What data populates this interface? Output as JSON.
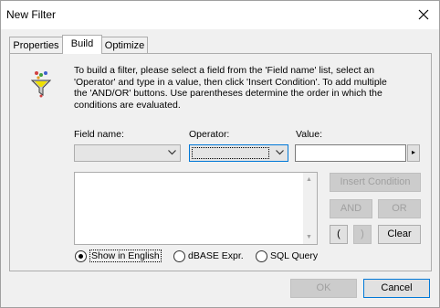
{
  "window": {
    "title": "New Filter"
  },
  "tabs": [
    {
      "label": "Properties"
    },
    {
      "label": "Build"
    },
    {
      "label": "Optimize"
    }
  ],
  "instructions": "To build a filter, please select a field from the 'Field name' list, select an 'Operator'  and type in a value, then click 'Insert Condition'. To add multiple the 'AND/OR' buttons.  Use parentheses determine the order in which the conditions are evaluated.",
  "fields": {
    "field_name_label": "Field name:",
    "operator_label": "Operator:",
    "value_label": "Value:",
    "field_name_value": "",
    "operator_value": "",
    "value_value": ""
  },
  "buttons": {
    "insert_condition": "Insert Condition",
    "and": "AND",
    "or": "OR",
    "open_paren": "(",
    "close_paren": ")",
    "clear": "Clear",
    "ok": "OK",
    "cancel": "Cancel",
    "value_picker": "▸"
  },
  "radios": [
    {
      "label": "Show in English",
      "selected": true
    },
    {
      "label": "dBASE Expr.",
      "selected": false
    },
    {
      "label": "SQL Query",
      "selected": false
    }
  ],
  "scroll": {
    "up": "▲",
    "down": "▼"
  },
  "icons": {
    "close": "close-icon",
    "filter": "filter-funnel-icon",
    "dropdown": "chevron-down-icon"
  }
}
